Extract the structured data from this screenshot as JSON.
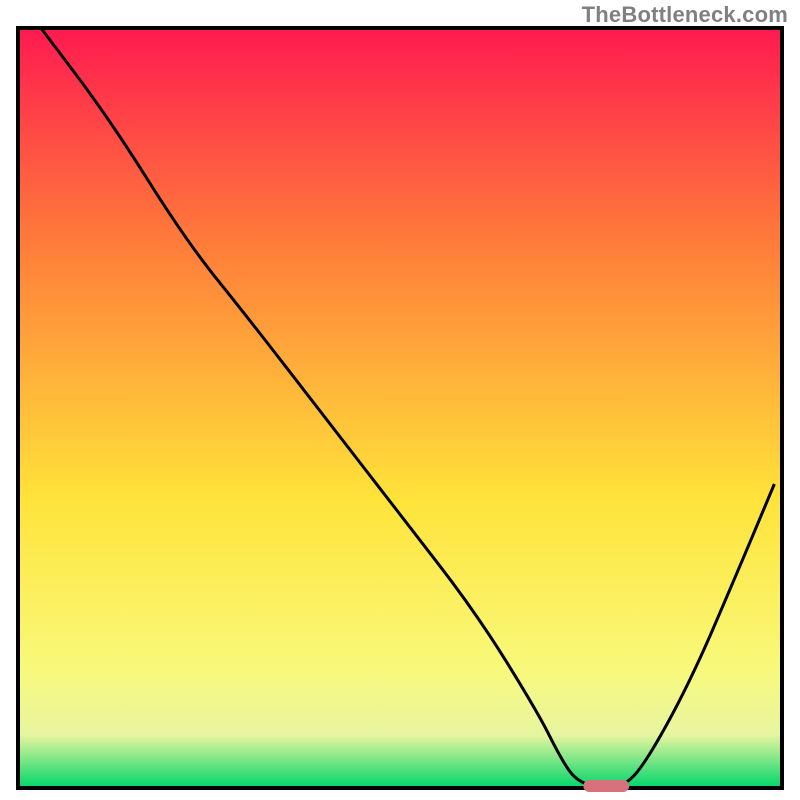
{
  "watermark": "TheBottleneck.com",
  "chart_data": {
    "type": "line",
    "title": "",
    "xlabel": "",
    "ylabel": "",
    "xlim": [
      0,
      100
    ],
    "ylim": [
      0,
      100
    ],
    "grid": false,
    "series": [
      {
        "name": "bottleneck-curve",
        "x": [
          3,
          12,
          22,
          30,
          40,
          50,
          60,
          68,
          71,
          73,
          76,
          79,
          82,
          88,
          94,
          99
        ],
        "y": [
          100,
          88,
          72,
          62,
          49,
          36,
          23,
          10,
          4,
          1,
          0,
          0,
          3,
          14,
          28,
          40
        ]
      }
    ],
    "optimum_marker": {
      "x_start": 74,
      "x_end": 80,
      "y": 0
    },
    "background": {
      "gradient_top": "#ff1a50",
      "gradient_mid1": "#ff7b3a",
      "gradient_mid2": "#ffe33a",
      "gradient_mid3": "#f8f97a",
      "gradient_bottom_band_top": "#e8f5a0",
      "gradient_bottom": "#00d66b"
    },
    "frame_color": "#000000",
    "curve_color": "#000000",
    "marker_color": "#d9717d"
  }
}
